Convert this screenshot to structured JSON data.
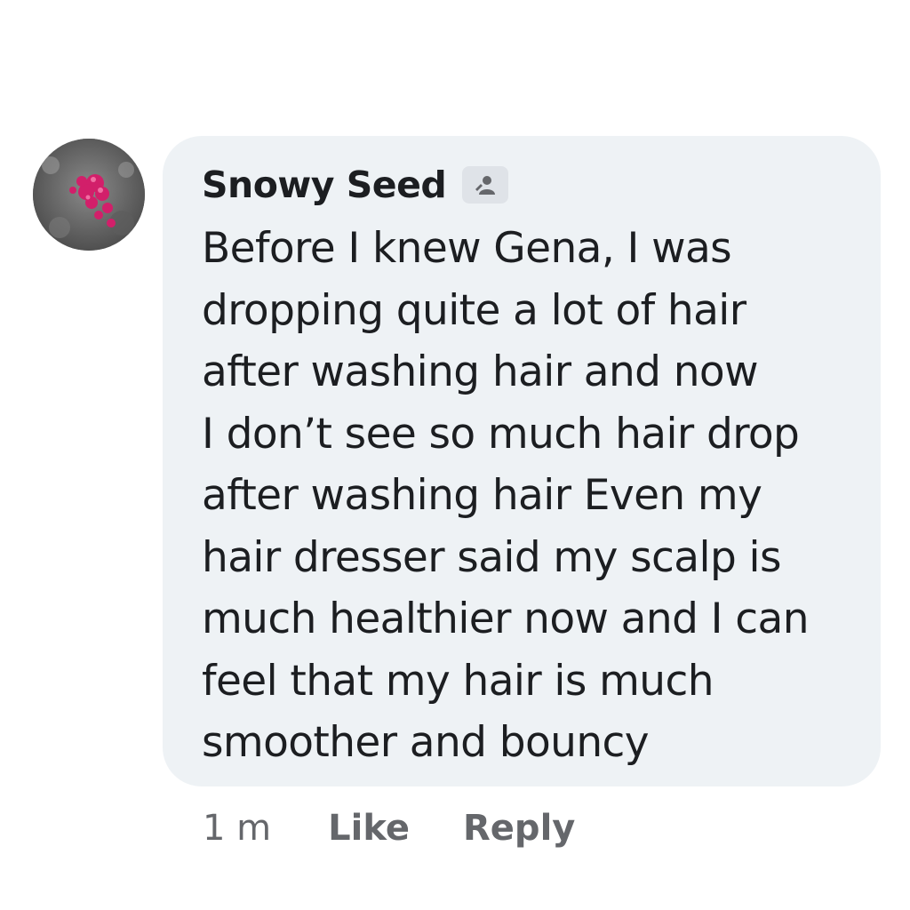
{
  "comment": {
    "author": "Snowy Seed",
    "author_badge_icon": "profile-badge-icon",
    "avatar_icon": "flower-avatar-icon",
    "text": "Before I knew Gena, I was\ndropping quite a lot of hair\nafter washing hair and now\nI don’t see so much hair drop\nafter washing hair  Even my\nhair dresser said my scalp is\nmuch healthier now and I can\nfeel that my hair is much\nsmoother and bouncy",
    "timestamp": "1 m",
    "like_label": "Like",
    "reply_label": "Reply"
  },
  "colors": {
    "bubble_background": "#eef2f5",
    "text": "#1c1e21",
    "secondary_text": "#65676b",
    "avatar_accent": "#d21f6a"
  }
}
